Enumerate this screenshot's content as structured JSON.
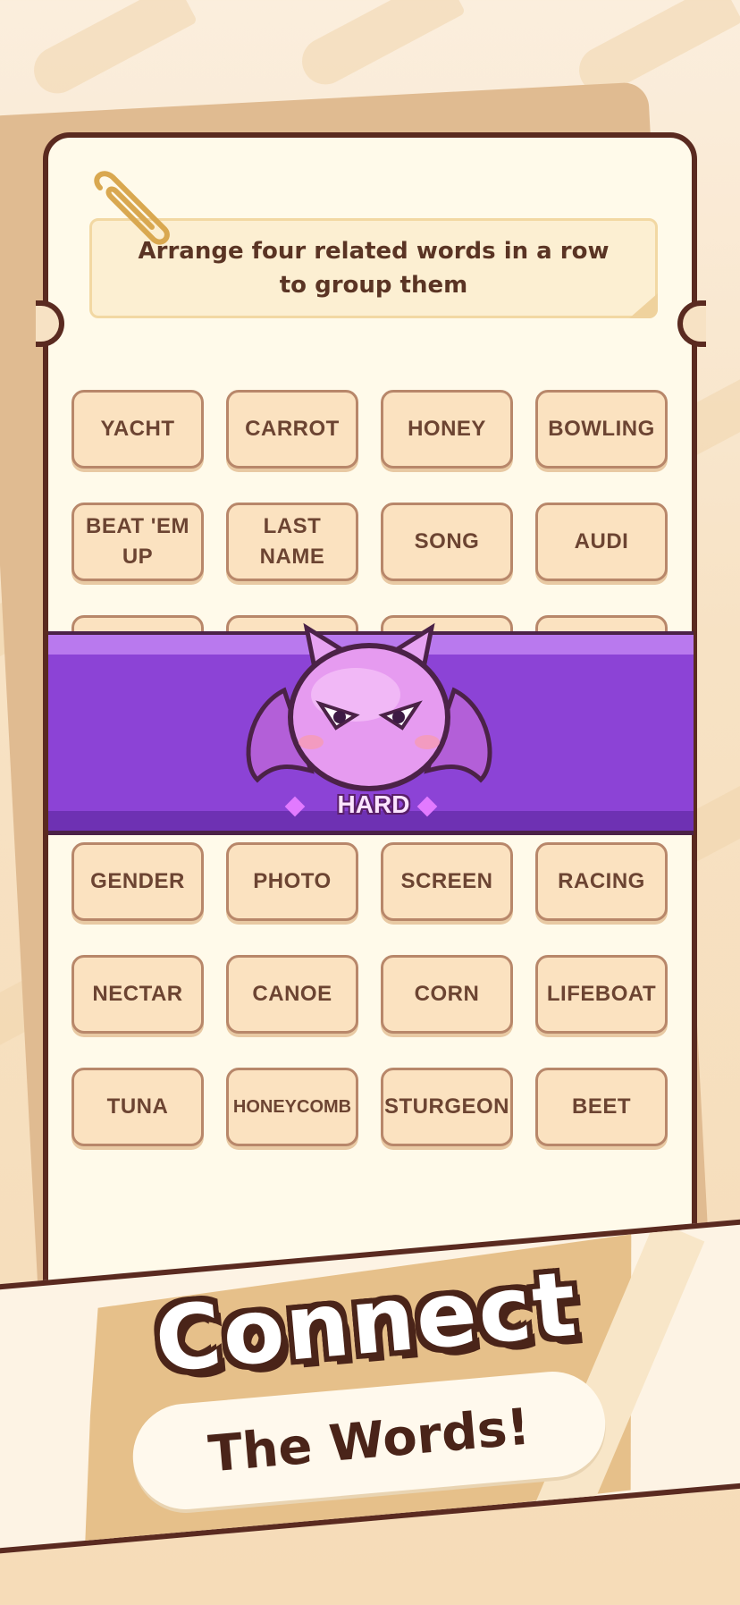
{
  "instruction": "Arrange four related words in a row to group them",
  "tiles_top": [
    [
      "YACHT",
      "CARROT",
      "HONEY",
      "BOWLING"
    ],
    [
      "BEAT 'EM UP",
      "LAST NAME",
      "SONG",
      "AUDI"
    ]
  ],
  "tiles_bottom": [
    [
      "GENDER",
      "PHOTO",
      "SCREEN",
      "RACING"
    ],
    [
      "NECTAR",
      "CANOE",
      "CORN",
      "LIFEBOAT"
    ],
    [
      "TUNA",
      "HONEYCOMB",
      "STURGEON",
      "BEET"
    ]
  ],
  "difficulty": {
    "label": "HARD",
    "mascot_icon": "purple-devil-bat-icon"
  },
  "promo": {
    "title": "Connect",
    "subtitle": "The Words!"
  },
  "colors": {
    "banner": "#8c43d6",
    "outline": "#5a2a20",
    "tile": "#fbe2c0",
    "card": "#fffaea"
  }
}
